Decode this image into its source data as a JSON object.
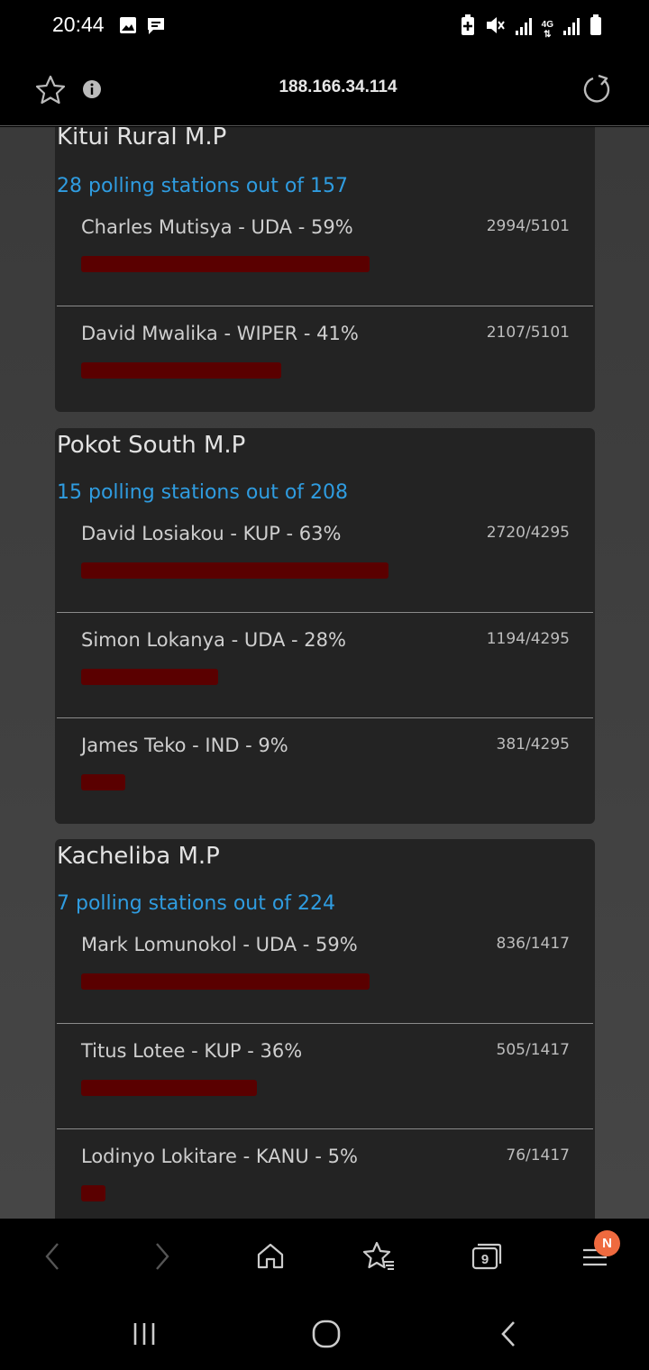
{
  "status_bar": {
    "time": "20:44",
    "left_icons": [
      "image-icon",
      "message-icon"
    ],
    "right_icons": [
      "battery-saver-icon",
      "mute-icon",
      "signal-icon",
      "4g-icon",
      "signal-icon",
      "battery-icon"
    ],
    "network_label": "4G"
  },
  "browser": {
    "url": "188.166.34.114",
    "tab_count": "9",
    "menu_badge": "N"
  },
  "accent_colors": {
    "link_blue": "#2f9ce0",
    "bar_red": "#5a0000",
    "badge_orange": "#ef6a3f"
  },
  "races": [
    {
      "title": "Kitui Rural M.P",
      "stations": "28 polling stations out of 157",
      "candidates": [
        {
          "label": "Charles Mutisya - UDA - 59%",
          "votes": "2994/5101",
          "percent": 59
        },
        {
          "label": "David Mwalika - WIPER - 41%",
          "votes": "2107/5101",
          "percent": 41
        }
      ]
    },
    {
      "title": "Pokot South M.P",
      "stations": "15 polling stations out of 208",
      "candidates": [
        {
          "label": "David Losiakou - KUP - 63%",
          "votes": "2720/4295",
          "percent": 63
        },
        {
          "label": "Simon Lokanya - UDA - 28%",
          "votes": "1194/4295",
          "percent": 28
        },
        {
          "label": "James Teko - IND - 9%",
          "votes": "381/4295",
          "percent": 9
        }
      ]
    },
    {
      "title": "Kacheliba M.P",
      "stations": "7 polling stations out of 224",
      "candidates": [
        {
          "label": "Mark Lomunokol - UDA - 59%",
          "votes": "836/1417",
          "percent": 59
        },
        {
          "label": "Titus Lotee - KUP - 36%",
          "votes": "505/1417",
          "percent": 36
        },
        {
          "label": "Lodinyo Lokitare - KANU - 5%",
          "votes": "76/1417",
          "percent": 5
        }
      ]
    }
  ]
}
